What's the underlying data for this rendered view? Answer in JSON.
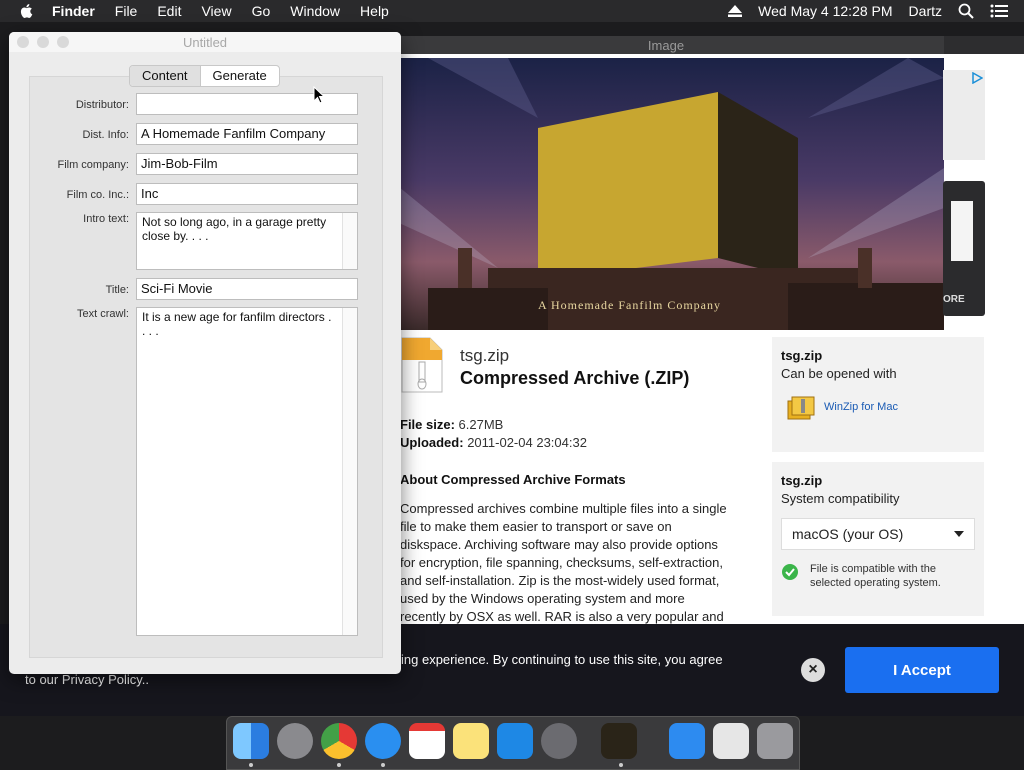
{
  "menubar": {
    "items": [
      "Finder",
      "File",
      "Edit",
      "View",
      "Go",
      "Window",
      "Help"
    ],
    "clock": "Wed May 4  12:28 PM",
    "user": "Dartz"
  },
  "background_window": {
    "title": "Image"
  },
  "hero": {
    "caption": "A Homemade Fanfilm Company"
  },
  "ad": {
    "more_label": "ORE"
  },
  "file": {
    "name": "tsg.zip",
    "type": "Compressed Archive (.ZIP)",
    "size_label": "File size:",
    "size": "6.27MB",
    "uploaded_label": "Uploaded:",
    "uploaded": "2011-02-04 23:04:32"
  },
  "about": {
    "heading": "About Compressed Archive Formats",
    "text": "Compressed archives combine multiple files into a single file to make them easier to transport or save on diskspace. Archiving software may also provide options for encryption, file spanning, checksums, self-extraction, and self-installation. Zip is the most-widely used format, used by the Windows operating system and more recently by OSX as well. RAR is also a very popular and"
  },
  "open_with": {
    "file": "tsg.zip",
    "subtitle": "Can be opened with",
    "app": "WinZip for Mac"
  },
  "compat": {
    "file": "tsg.zip",
    "subtitle": "System compatibility",
    "os": "macOS (your OS)",
    "note": "File is compatible with the selected operating system."
  },
  "cookie": {
    "line1": "ing experience. By continuing to use this site, you agree",
    "line2": "to our Privacy Policy..",
    "accept": "I Accept"
  },
  "window": {
    "title": "Untitled",
    "tabs": [
      "Content",
      "Generate"
    ],
    "fields": {
      "distributor_label": "Distributor:",
      "distributor": "",
      "dist_info_label": "Dist. Info:",
      "dist_info": "A Homemade Fanfilm Company",
      "film_company_label": "Film company:",
      "film_company": "Jim-Bob-Film",
      "film_inc_label": "Film co. Inc.:",
      "film_inc": "Inc",
      "intro_label": "Intro text:",
      "intro": "Not so long ago, in a garage pretty close by. . . .",
      "title_label": "Title:",
      "title": "Sci-Fi Movie",
      "crawl_label": "Text crawl:",
      "crawl": "It is a new age for fanfilm directors . . . ."
    }
  },
  "colors": {
    "accent": "#1a6ff0",
    "menubar": "#2a2a2c",
    "check": "#3bb54a"
  }
}
